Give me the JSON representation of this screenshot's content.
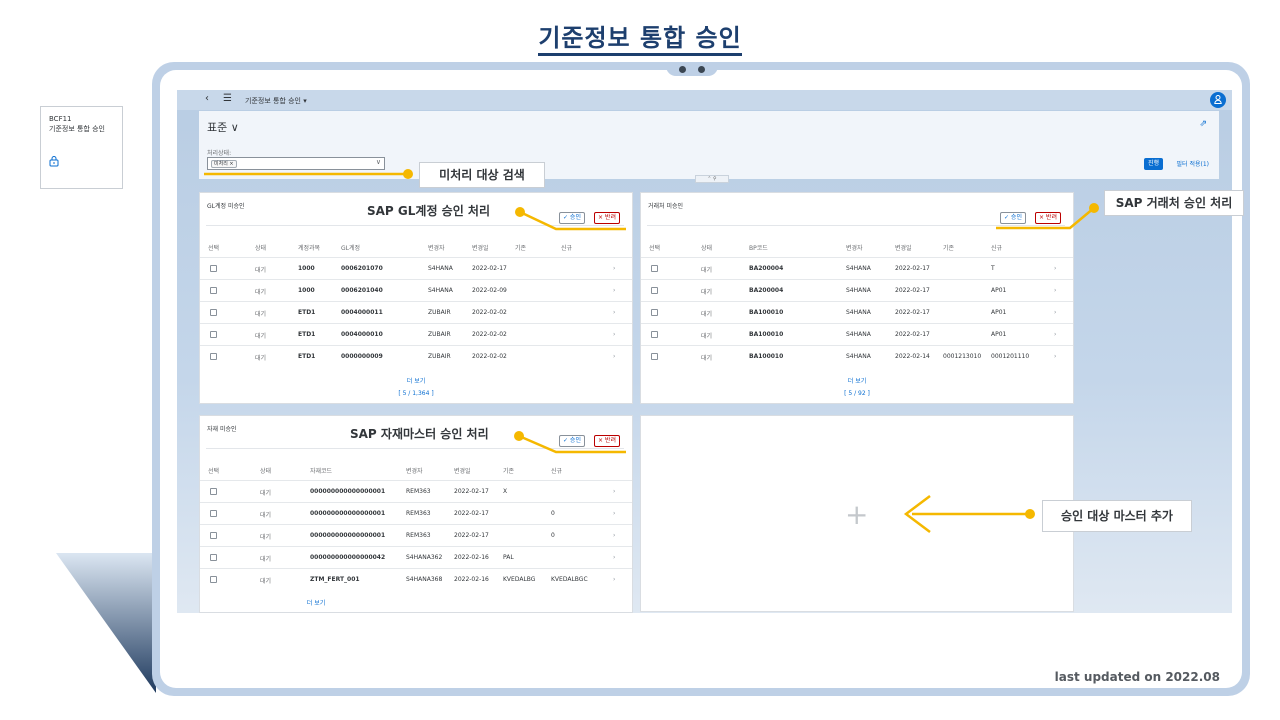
{
  "slide": {
    "title": "기준정보 통합 승인",
    "footer": "last updated on 2022.08"
  },
  "tile": {
    "line1": "BCF11",
    "line2": "기준정보 통합 승인",
    "icon": "lock-icon"
  },
  "shell": {
    "back_icon": "‹",
    "menu_icon": "☰",
    "title": "기준정보 통합 승인 ▾",
    "user_icon": "user-icon"
  },
  "filter": {
    "variant": "표준 ∨",
    "status_label": "처리상태:",
    "token": "미처리 ×",
    "go_label": "진행",
    "filters_label": "필터 적용(1)"
  },
  "callouts": {
    "search": "미처리 대상 검색",
    "gl": "SAP GL계정 승인 처리",
    "vendor": "SAP 거래처 승인 처리",
    "material": "SAP 자재마스터 승인 처리",
    "add": "승인 대상 마스터 추가"
  },
  "buttons": {
    "approve": "✓ 승인",
    "reject": "× 반려"
  },
  "gl_card": {
    "title": "GL계정 미승인",
    "columns": [
      "선택",
      "상태",
      "계정과목",
      "GL계정",
      "변경자",
      "변경일",
      "기존",
      "신규"
    ],
    "rows": [
      {
        "status": "대기",
        "acct": "1000",
        "gl": "0006201070",
        "user": "S4HANA",
        "date": "2022-02-17",
        "old": "",
        "new": ""
      },
      {
        "status": "대기",
        "acct": "1000",
        "gl": "0006201040",
        "user": "S4HANA",
        "date": "2022-02-09",
        "old": "",
        "new": ""
      },
      {
        "status": "대기",
        "acct": "ETD1",
        "gl": "0004000011",
        "user": "ZUBAIR",
        "date": "2022-02-02",
        "old": "",
        "new": ""
      },
      {
        "status": "대기",
        "acct": "ETD1",
        "gl": "0004000010",
        "user": "ZUBAIR",
        "date": "2022-02-02",
        "old": "",
        "new": ""
      },
      {
        "status": "대기",
        "acct": "ETD1",
        "gl": "0000000009",
        "user": "ZUBAIR",
        "date": "2022-02-02",
        "old": "",
        "new": ""
      }
    ],
    "more": "더 보기",
    "count": "[ 5 / 1,364 ]"
  },
  "vendor_card": {
    "title": "거래처 미승인",
    "columns": [
      "선택",
      "상태",
      "BP코드",
      "변경자",
      "변경일",
      "기존",
      "신규"
    ],
    "rows": [
      {
        "status": "대기",
        "bp": "BA200004",
        "user": "S4HANA",
        "date": "2022-02-17",
        "old": "",
        "new": "T"
      },
      {
        "status": "대기",
        "bp": "BA200004",
        "user": "S4HANA",
        "date": "2022-02-17",
        "old": "",
        "new": "AP01"
      },
      {
        "status": "대기",
        "bp": "BA100010",
        "user": "S4HANA",
        "date": "2022-02-17",
        "old": "",
        "new": "AP01"
      },
      {
        "status": "대기",
        "bp": "BA100010",
        "user": "S4HANA",
        "date": "2022-02-17",
        "old": "",
        "new": "AP01"
      },
      {
        "status": "대기",
        "bp": "BA100010",
        "user": "S4HANA",
        "date": "2022-02-14",
        "old": "0001213010",
        "new": "0001201110"
      }
    ],
    "more": "더 보기",
    "count": "[ 5 / 92 ]"
  },
  "material_card": {
    "title": "자재 미승인",
    "columns": [
      "선택",
      "상태",
      "자재코드",
      "변경자",
      "변경일",
      "기존",
      "신규"
    ],
    "rows": [
      {
        "status": "대기",
        "mat": "000000000000000001",
        "user": "REM363",
        "date": "2022-02-17",
        "old": "X",
        "new": ""
      },
      {
        "status": "대기",
        "mat": "000000000000000001",
        "user": "REM363",
        "date": "2022-02-17",
        "old": "",
        "new": "0"
      },
      {
        "status": "대기",
        "mat": "000000000000000001",
        "user": "REM363",
        "date": "2022-02-17",
        "old": "",
        "new": "0"
      },
      {
        "status": "대기",
        "mat": "000000000000000042",
        "user": "S4HANA362",
        "date": "2022-02-16",
        "old": "PAL",
        "new": ""
      },
      {
        "status": "대기",
        "mat": "ZTM_FERT_001",
        "user": "S4HANA368",
        "date": "2022-02-16",
        "old": "KVEDALBG",
        "new": "KVEDALBGC"
      }
    ],
    "more": "더 보기"
  },
  "add_card": {
    "plus": "+"
  },
  "colors": {
    "accent": "#0a6ed1",
    "callout_line": "#f5b800",
    "title": "#1d3f6e",
    "frame": "#bed0e6"
  }
}
